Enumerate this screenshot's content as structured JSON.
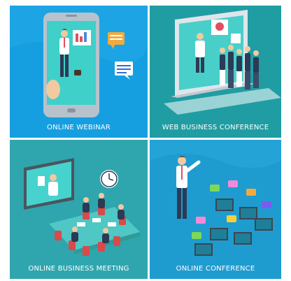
{
  "tiles": [
    {
      "caption": "ONLINE WEBINAR"
    },
    {
      "caption": "WEB BUSINESS CONFERENCE"
    },
    {
      "caption": "ONLINE BUSINESS MEETING"
    },
    {
      "caption": "ONLINE CONFERENCE"
    }
  ],
  "colors": {
    "tile1_bg": "#169fe0",
    "tile2_bg": "#1f9da2",
    "tile3_bg": "#2fa6ae",
    "tile4_bg": "#1e9cd0"
  }
}
